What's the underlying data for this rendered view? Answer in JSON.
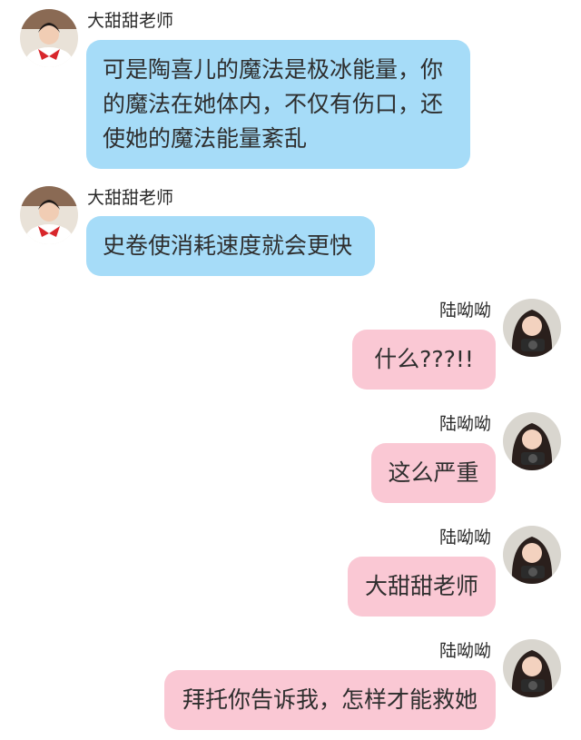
{
  "messages": [
    {
      "side": "left",
      "sender": "大甜甜老师",
      "text": "可是陶喜儿的魔法是极冰能量，你的魔法在她体内，不仅有伤口，还使她的魔法能量紊乱"
    },
    {
      "side": "left",
      "sender": "大甜甜老师",
      "text": "史卷使消耗速度就会更快"
    },
    {
      "side": "right",
      "sender": "陆呦呦",
      "text": "什么???!!"
    },
    {
      "side": "right",
      "sender": "陆呦呦",
      "text": "这么严重"
    },
    {
      "side": "right",
      "sender": "陆呦呦",
      "text": "大甜甜老师"
    },
    {
      "side": "right",
      "sender": "陆呦呦",
      "text": "拜托你告诉我，怎样才能救她"
    }
  ],
  "colors": {
    "left_bubble": "#a6dcf8",
    "right_bubble": "#fac8d4"
  }
}
